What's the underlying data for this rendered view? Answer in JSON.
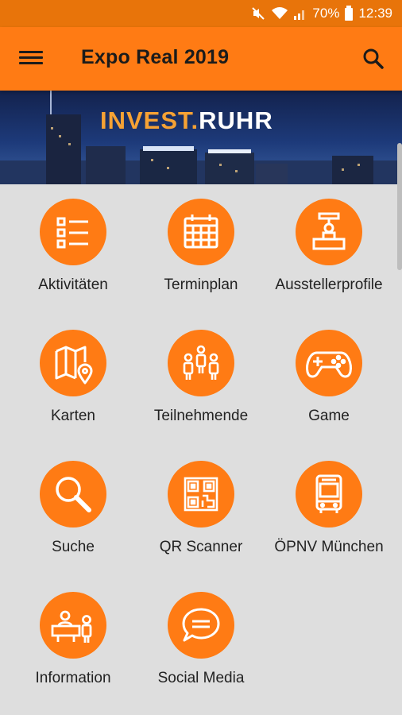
{
  "status": {
    "battery": "70%",
    "time": "12:39"
  },
  "header": {
    "title": "Expo Real 2019"
  },
  "banner": {
    "text_orange": "INVEST.",
    "text_white": "RUHR"
  },
  "colors": {
    "accent": "#ff7b14",
    "statusbar": "#e8740a",
    "background": "#dedede"
  },
  "tiles": [
    {
      "label": "Aktivitäten",
      "icon": "checklist-icon"
    },
    {
      "label": "Terminplan",
      "icon": "calendar-icon"
    },
    {
      "label": "Ausstellerprofile",
      "icon": "booth-icon"
    },
    {
      "label": "Karten",
      "icon": "map-icon"
    },
    {
      "label": "Teilnehmende",
      "icon": "people-icon"
    },
    {
      "label": "Game",
      "icon": "gamepad-icon"
    },
    {
      "label": "Suche",
      "icon": "magnifier-icon"
    },
    {
      "label": "QR Scanner",
      "icon": "qr-code-icon"
    },
    {
      "label": "ÖPNV München",
      "icon": "bus-icon"
    },
    {
      "label": "Information",
      "icon": "info-desk-icon"
    },
    {
      "label": "Social Media",
      "icon": "chat-bubble-icon"
    }
  ]
}
